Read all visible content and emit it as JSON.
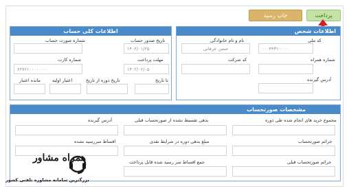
{
  "toolbar": {
    "pay_label": "پرداخت",
    "print_label": "چاپ رسید"
  },
  "personal": {
    "title": "اطلاعات شخص",
    "code_label": "کد ملی",
    "code_value": "۰۰۰۴۴۳۱۰۰۰۰",
    "name_label": "نام و نام خانوادگی",
    "name_value": "حسن عرفانی",
    "phone_label": "شماره همراه",
    "company_label": "کد شرکت",
    "address_label": "آدرس گیرنده"
  },
  "account": {
    "title": "اطلاعات کلی حساب",
    "invoice_date_label": "تاریخ صدور حساب",
    "invoice_date_value": "۱۴۰۲/۰۱/۲۵",
    "invoice_no_label": "شماره صورت حساب",
    "due_label": "مهلت پرداخت",
    "due_value": "۱۴۰۲/۰۲/۰۵",
    "card_label": "شماره کارت",
    "card_value": "۶۲۷۶۱۰۰۰۰۰۰۰۰",
    "to_date_label": "تا تاریخ",
    "from_date_label": "تاریخ دوره از تاریخ",
    "initial_credit_label": "اعتبار اولیه",
    "remaining_credit_label": "مانده اعتبار"
  },
  "billing": {
    "title": "مشخصات صورتحساب",
    "purchases_label": "مجموع خرید های انجام شده طی دوره",
    "installment_debt_label": "بدهی تقسیط نشده از صورتحساب قبلی",
    "recipient_address_label": "آدرس گیرنده",
    "bill_fine_label": "جرائم صورتحساب",
    "cash_debt_label": "مبلغ بدهی دوره در شرایط نقدی",
    "overdue_installments_label": "اقساط سررسید نشده",
    "prev_fine_label": "جرائم صورتحساب قبلی",
    "total_due_label": "جمع اقساط سر رسید شده قابل پرداخت"
  },
  "watermark": {
    "title": "همراه مشاور",
    "subtitle": "بزرگترین سامانه مشاوره تلفنی کشور"
  },
  "colors": {
    "header_blue": "#4a8ac8",
    "pay_green": "#c5e3a5",
    "print_gold": "#d9b46a",
    "arrow_red": "#d32020"
  }
}
